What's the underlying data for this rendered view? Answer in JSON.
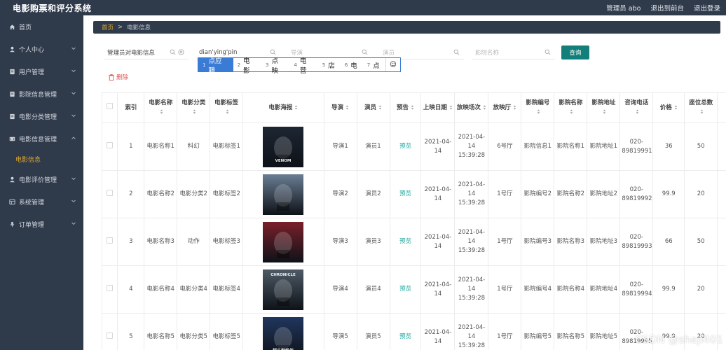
{
  "app": {
    "title": "电影购票和评分系统"
  },
  "header": {
    "user": "管理员 abo",
    "links": [
      "退出到前台",
      "退出登录"
    ]
  },
  "sidebar": {
    "items": [
      {
        "label": "首页",
        "icon": "home-icon",
        "chevron": false
      },
      {
        "label": "个人中心",
        "icon": "user-icon",
        "chevron": true
      },
      {
        "label": "用户管理",
        "icon": "file-icon",
        "chevron": true
      },
      {
        "label": "影院信息管理",
        "icon": "file-icon",
        "chevron": true
      },
      {
        "label": "电影分类管理",
        "icon": "file-icon",
        "chevron": true
      },
      {
        "label": "电影信息管理",
        "icon": "film-icon",
        "chevron": true,
        "expanded": true
      },
      {
        "label": "电影评价管理",
        "icon": "user-icon",
        "chevron": true
      },
      {
        "label": "系统管理",
        "icon": "grid-icon",
        "chevron": true
      },
      {
        "label": "订单管理",
        "icon": "mic-icon",
        "chevron": true
      }
    ],
    "sub_item": "电影信息"
  },
  "breadcrumb": {
    "home": "首页",
    "separator": ">",
    "current": "电影信息"
  },
  "search": {
    "field1_value": "管理员对电影信息",
    "field2_value": "dian'ying'pin",
    "field3_placeholder": "导演",
    "field4_placeholder": "演员",
    "field5_placeholder": "影院名称",
    "query_label": "查询"
  },
  "ime": {
    "candidates": [
      {
        "n": "1",
        "text": "点应聘"
      },
      {
        "n": "2",
        "text": "电影"
      },
      {
        "n": "3",
        "text": "点映"
      },
      {
        "n": "4",
        "text": "电营"
      },
      {
        "n": "5",
        "text": "店"
      },
      {
        "n": "6",
        "text": "电"
      },
      {
        "n": "7",
        "text": "点"
      }
    ],
    "emoji": "☺"
  },
  "toolbar": {
    "delete_label": "删除"
  },
  "table": {
    "headers": [
      "索引",
      "电影名称",
      "电影分类",
      "电影标签",
      "电影海报",
      "导演",
      "演员",
      "预告",
      "上映日期",
      "放映场次",
      "放映厅",
      "影院编号",
      "影院名称",
      "影院地址",
      "咨询电话",
      "价格",
      "座位总数"
    ],
    "rows": [
      {
        "index": "1",
        "name": "电影名称1",
        "category": "科幻",
        "tag": "电影标签1",
        "director": "导演1",
        "actor": "演员1",
        "trailer": "预览",
        "date": "2021-04-14",
        "session": "2021-04-14 15:39:28",
        "hall": "6号厅",
        "cinema_no": "影院信息1",
        "cinema_name": "影院名称1",
        "address": "影院地址1",
        "phone": "020-89819991",
        "price": "36",
        "seats": "50"
      },
      {
        "index": "2",
        "name": "电影名称2",
        "category": "电影分类2",
        "tag": "电影标签2",
        "director": "导演2",
        "actor": "演员2",
        "trailer": "预览",
        "date": "2021-04-14",
        "session": "2021-04-14 15:39:28",
        "hall": "1号厅",
        "cinema_no": "影院编号2",
        "cinema_name": "影院名称2",
        "address": "影院地址2",
        "phone": "020-89819992",
        "price": "99.9",
        "seats": "20"
      },
      {
        "index": "3",
        "name": "电影名称3",
        "category": "动作",
        "tag": "电影标签3",
        "director": "导演3",
        "actor": "演员3",
        "trailer": "预览",
        "date": "2021-04-14",
        "session": "2021-04-14 15:39:28",
        "hall": "1号厅",
        "cinema_no": "影院编号3",
        "cinema_name": "影院名称3",
        "address": "影院地址3",
        "phone": "020-89819993",
        "price": "66",
        "seats": "50"
      },
      {
        "index": "4",
        "name": "电影名称4",
        "category": "电影分类4",
        "tag": "电影标签4",
        "director": "导演4",
        "actor": "演员4",
        "trailer": "预览",
        "date": "2021-04-14",
        "session": "2021-04-14 15:39:28",
        "hall": "1号厅",
        "cinema_no": "影院编号4",
        "cinema_name": "影院名称4",
        "address": "影院地址4",
        "phone": "020-89819994",
        "price": "99.9",
        "seats": "20"
      },
      {
        "index": "5",
        "name": "电影名称5",
        "category": "电影分类5",
        "tag": "电影标签5",
        "director": "导演5",
        "actor": "演员5",
        "trailer": "预览",
        "date": "2021-04-14",
        "session": "2021-04-14 15:39:28",
        "hall": "1号厅",
        "cinema_no": "影院编号5",
        "cinema_name": "影院名称5",
        "address": "影院地址5",
        "phone": "020-89819995",
        "price": "99.9",
        "seats": "20"
      }
    ],
    "poster_colors": [
      "#1d2633",
      "#6a7e94",
      "#7a1f2a",
      "#4d5a66",
      "#20365e"
    ],
    "poster_texts": [
      "VENOM",
      "",
      "",
      "CHRONICLE",
      "超凡蜘蛛侠"
    ]
  },
  "watermark": "CSDN @sheji401",
  "colors": {
    "sidebar_bg": "#2f3a4a",
    "accent_yellow": "#e0a82e",
    "teal": "#137f7a",
    "danger": "#e05353"
  }
}
